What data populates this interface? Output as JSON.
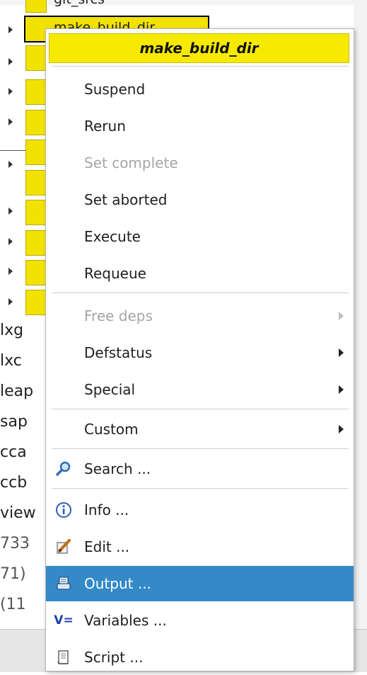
{
  "tree": {
    "top_label": "git_srcs",
    "selected_node_label": "make_build_dir",
    "side_labels": [
      "lxg",
      "lxc",
      "leap",
      "sap",
      "cca",
      "ccb",
      "view",
      "733",
      "71)",
      "(11"
    ]
  },
  "menu": {
    "title": "make_build_dir",
    "items": [
      {
        "label": "Suspend",
        "enabled": true
      },
      {
        "label": "Rerun",
        "enabled": true
      },
      {
        "label": "Set complete",
        "enabled": false
      },
      {
        "label": "Set aborted",
        "enabled": true
      },
      {
        "label": "Execute",
        "enabled": true
      },
      {
        "label": "Requeue",
        "enabled": true
      },
      {
        "label": "Free deps",
        "enabled": false,
        "submenu": true
      },
      {
        "label": "Defstatus",
        "enabled": true,
        "submenu": true
      },
      {
        "label": "Special",
        "enabled": true,
        "submenu": true
      },
      {
        "label": "Custom",
        "enabled": true,
        "submenu": true
      },
      {
        "label": "Search ...",
        "enabled": true,
        "icon": "search-icon"
      },
      {
        "label": "Info ...",
        "enabled": true,
        "icon": "info-icon"
      },
      {
        "label": "Edit ...",
        "enabled": true,
        "icon": "edit-icon"
      },
      {
        "label": "Output ...",
        "enabled": true,
        "icon": "output-icon",
        "highlighted": true
      },
      {
        "label": "Variables ...",
        "enabled": true,
        "icon": "variables-icon"
      },
      {
        "label": "Script ...",
        "enabled": true,
        "icon": "script-icon"
      }
    ],
    "variables_icon_text": "V="
  },
  "colors": {
    "node_yellow": "#f2e200",
    "title_yellow": "#f7ea00",
    "highlight_blue": "#3489c7"
  }
}
